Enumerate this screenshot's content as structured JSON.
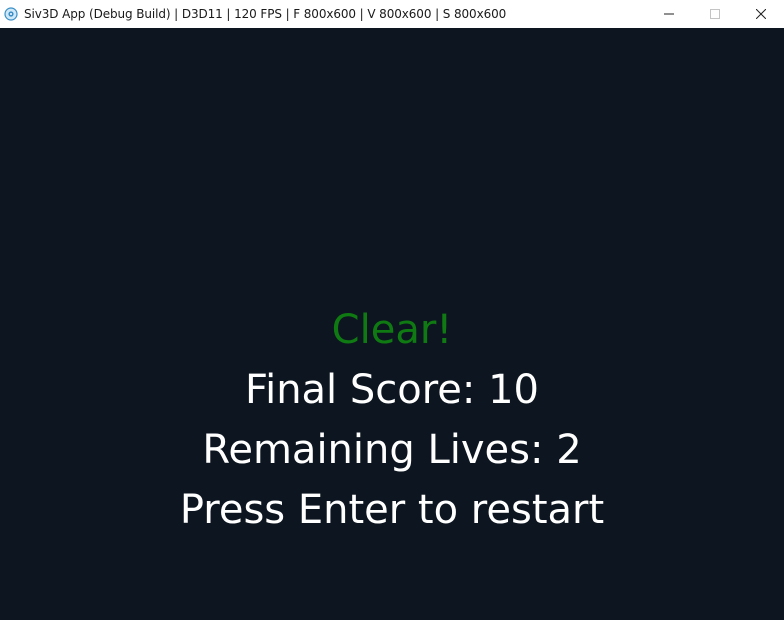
{
  "window": {
    "title": "Siv3D App (Debug Build) | D3D11 | 120 FPS | F 800x600 | V 800x600 | S 800x600"
  },
  "game": {
    "clear_text": "Clear!",
    "final_score_text": "Final Score: 10",
    "remaining_lives_text": "Remaining Lives: 2",
    "restart_prompt": "Press Enter to restart",
    "final_score": 10,
    "remaining_lives": 2
  },
  "colors": {
    "background": "#0d1620",
    "clear_text": "#0f7a12",
    "body_text": "#ffffff"
  },
  "icons": {
    "app": "siv3d-app-icon",
    "minimize": "minimize-icon",
    "maximize": "maximize-icon",
    "close": "close-icon"
  }
}
